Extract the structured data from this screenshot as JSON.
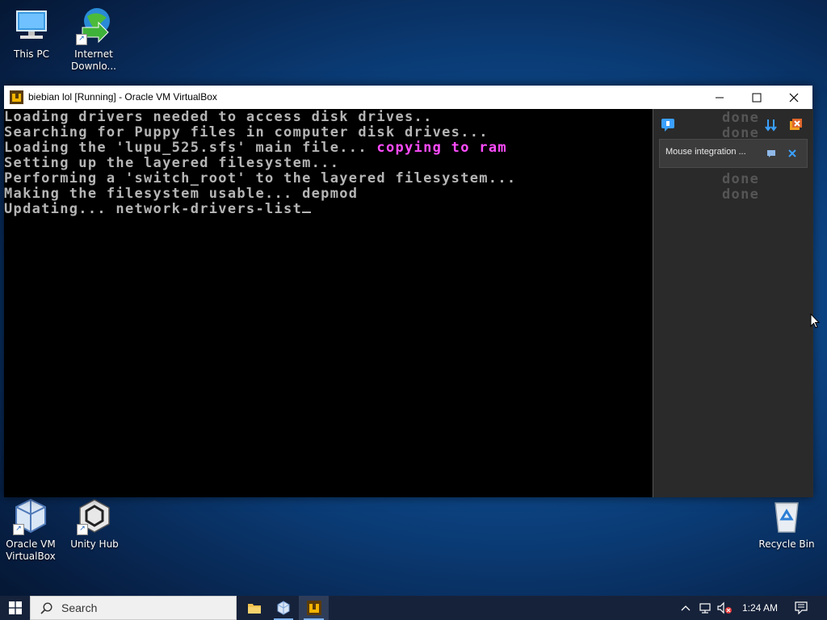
{
  "desktop": {
    "icons_top": [
      {
        "label": "This PC"
      },
      {
        "label": "Internet Downlo..."
      }
    ],
    "icons_bottom": [
      {
        "label": "Oracle VM VirtualBox"
      },
      {
        "label": "Unity Hub"
      }
    ],
    "recycle_bin": {
      "label": "Recycle Bin"
    }
  },
  "window": {
    "title": "biebian lol [Running] - Oracle VM VirtualBox",
    "controls": {
      "minimize": "—",
      "maximize": "☐",
      "close": "✕"
    }
  },
  "console": {
    "lines": [
      {
        "text": "Loading drivers needed to access disk drives..",
        "highlight": ""
      },
      {
        "text": "Searching for Puppy files in computer disk drives...",
        "highlight": ""
      },
      {
        "text": "Loading the 'lupu_525.sfs' main file... ",
        "highlight": "copying to ram"
      },
      {
        "text": "Setting up the layered filesystem...",
        "highlight": ""
      },
      {
        "text": "Performing a 'switch_root' to the layered filesystem...",
        "highlight": ""
      },
      {
        "text": "Making the filesystem usable... depmod",
        "highlight": ""
      },
      {
        "text": "Updating... network-drivers-list",
        "highlight": ""
      }
    ],
    "status_words": [
      "done",
      "done",
      "done",
      "done"
    ]
  },
  "notification_panel": {
    "message": "Mouse integration ..."
  },
  "taskbar": {
    "search_placeholder": "Search",
    "clock": "1:24 AM"
  },
  "colors": {
    "console_text": "#b5b5b5",
    "console_highlight": "#ff4cff",
    "taskbar": "#16223a"
  }
}
